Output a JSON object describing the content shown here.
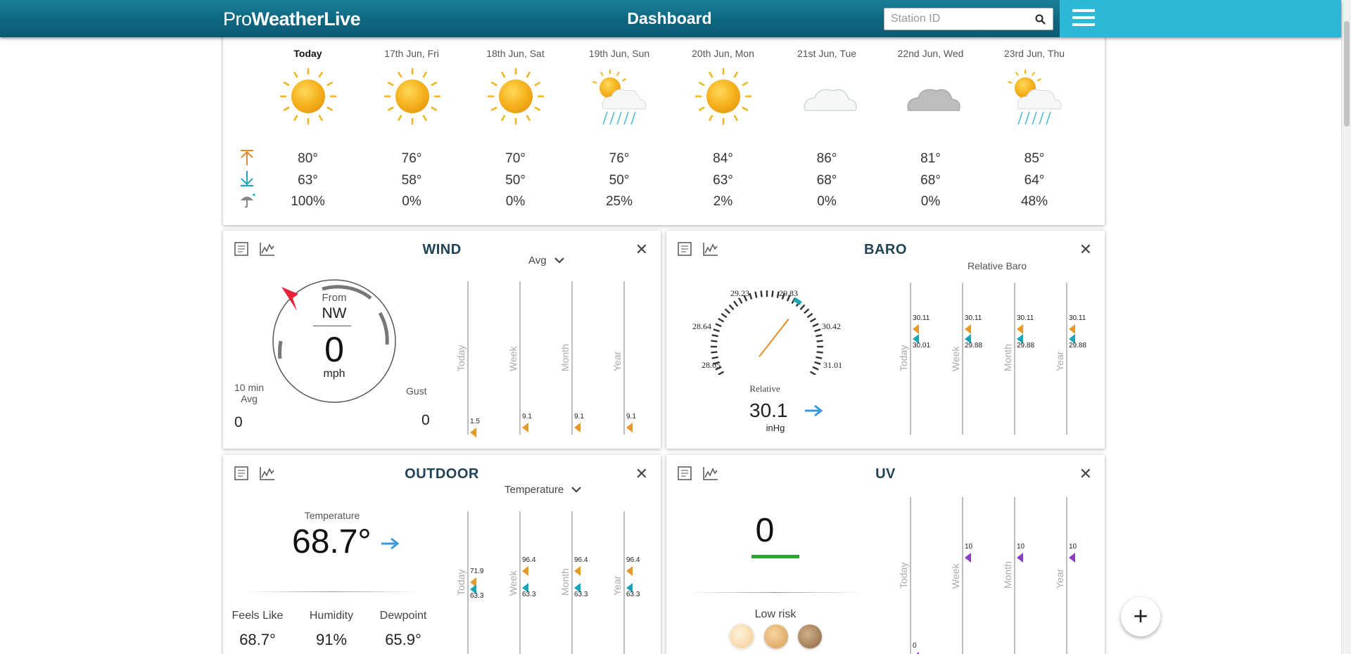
{
  "header": {
    "logo_light": "Pro",
    "logo_bold": "WeatherLive",
    "title": "Dashboard",
    "search_placeholder": "Station ID"
  },
  "forecast": {
    "days": [
      {
        "label": "Today",
        "icon": "sun-icon",
        "high": "80°",
        "low": "63°",
        "precip": "100%"
      },
      {
        "label": "17th Jun, Fri",
        "icon": "sun-icon",
        "high": "76°",
        "low": "58°",
        "precip": "0%"
      },
      {
        "label": "18th Jun, Sat",
        "icon": "sun-icon",
        "high": "70°",
        "low": "50°",
        "precip": "0%"
      },
      {
        "label": "19th Jun, Sun",
        "icon": "sun-rain-cloud-icon",
        "high": "76°",
        "low": "50°",
        "precip": "25%"
      },
      {
        "label": "20th Jun, Mon",
        "icon": "sun-icon",
        "high": "84°",
        "low": "63°",
        "precip": "2%"
      },
      {
        "label": "21st Jun, Tue",
        "icon": "white-cloud-icon",
        "high": "86°",
        "low": "68°",
        "precip": "0%"
      },
      {
        "label": "22nd Jun, Wed",
        "icon": "grey-cloud-icon",
        "high": "81°",
        "low": "68°",
        "precip": "0%"
      },
      {
        "label": "23rd Jun, Thu",
        "icon": "sun-rain-cloud-icon",
        "high": "85°",
        "low": "64°",
        "precip": "48%"
      }
    ]
  },
  "wind": {
    "title": "WIND",
    "dropdown": "Avg",
    "from_label": "From",
    "direction": "NW",
    "speed": "0",
    "unit": "mph",
    "avg_label": "10 min Avg",
    "avg_value": "0",
    "gust_label": "Gust",
    "gust_value": "0",
    "periods": [
      {
        "label": "Today",
        "value": "1.5"
      },
      {
        "label": "Week",
        "value": "9.1"
      },
      {
        "label": "Month",
        "value": "9.1"
      },
      {
        "label": "Year",
        "value": "9.1"
      }
    ]
  },
  "baro": {
    "title": "BARO",
    "subtitle": "Relative Baro",
    "scale": [
      "28.05",
      "28.64",
      "29.23",
      "29.83",
      "30.42",
      "31.01"
    ],
    "reading_label": "Relative",
    "value": "30.1",
    "unit": "inHg",
    "periods": [
      {
        "label": "Today",
        "high": "30.11",
        "low": "30.01"
      },
      {
        "label": "Week",
        "high": "30.11",
        "low": "29.88"
      },
      {
        "label": "Month",
        "high": "30.11",
        "low": "29.88"
      },
      {
        "label": "Year",
        "high": "30.11",
        "low": "29.88"
      }
    ]
  },
  "outdoor": {
    "title": "OUTDOOR",
    "dropdown": "Temperature",
    "temp_label": "Temperature",
    "temp": "68.7°",
    "feels_label": "Feels Like",
    "feels": "68.7°",
    "humidity_label": "Humidity",
    "humidity": "91%",
    "dew_label": "Dewpoint",
    "dew": "65.9°",
    "periods": [
      {
        "label": "Today",
        "high": "71.9",
        "low": "63.3"
      },
      {
        "label": "Week",
        "high": "96.4",
        "low": "63.3"
      },
      {
        "label": "Month",
        "high": "96.4",
        "low": "63.3"
      },
      {
        "label": "Year",
        "high": "96.4",
        "low": "63.3"
      }
    ]
  },
  "uv": {
    "title": "UV",
    "value": "0",
    "risk": "Low risk",
    "periods": [
      {
        "label": "Today",
        "value": "0"
      },
      {
        "label": "Week",
        "value": "10"
      },
      {
        "label": "Month",
        "value": "10"
      },
      {
        "label": "Year",
        "value": "10"
      }
    ]
  },
  "colors": {
    "accent": "#2fb7d7",
    "header": "#0e6680",
    "high": "#e59a2b",
    "low": "#1aa4b5",
    "uv": "#8a3fc1"
  }
}
